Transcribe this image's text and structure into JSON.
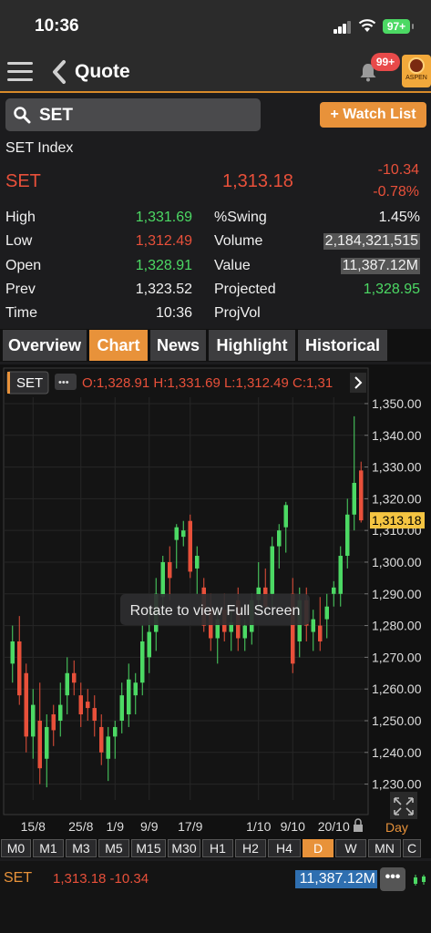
{
  "status_bar": {
    "time": "10:36",
    "battery": "97+"
  },
  "nav": {
    "title": "Quote",
    "notification_badge": "99+",
    "logo_text": "ASPEN"
  },
  "search": {
    "value": "SET",
    "watch_button": "+ Watch List"
  },
  "quote": {
    "index_name": "SET Index",
    "symbol": "SET",
    "last": "1,313.18",
    "change": "-10.34",
    "change_pct": "-0.78%",
    "rows": [
      {
        "l1": "High",
        "v1": "1,331.69",
        "c1": "green",
        "l2": "%Swing",
        "v2": "1.45%",
        "c2": "white",
        "h2": false
      },
      {
        "l1": "Low",
        "v1": "1,312.49",
        "c1": "red",
        "l2": "Volume",
        "v2": "2,184,321,515",
        "c2": "white",
        "h2": true
      },
      {
        "l1": "Open",
        "v1": "1,328.91",
        "c1": "green",
        "l2": "Value",
        "v2": "11,387.12M",
        "c2": "white",
        "h2": true
      },
      {
        "l1": "Prev",
        "v1": "1,323.52",
        "c1": "white",
        "l2": "Projected",
        "v2": "1,328.95",
        "c2": "green",
        "h2": false
      },
      {
        "l1": "Time",
        "v1": "10:36",
        "c1": "white",
        "l2": "ProjVol",
        "v2": "",
        "c2": "white",
        "h2": false
      }
    ]
  },
  "tabs": [
    "Overview",
    "Chart",
    "News",
    "Highlight",
    "Historical"
  ],
  "active_tab": "Chart",
  "chart_header": {
    "symbol": "SET",
    "more": "•••",
    "ohlc": "O:1,328.91  H:1,331.69  L:1,312.49  C:1,31"
  },
  "overlay_text": "Rotate to view Full Screen",
  "timeframe_label": "Day",
  "chart_data": {
    "type": "candlestick",
    "ylim": [
      1225,
      1352
    ],
    "y_ticks": [
      "1,350.00",
      "1,340.00",
      "1,330.00",
      "1,320.00",
      "1,310.00",
      "1,300.00",
      "1,290.00",
      "1,280.00",
      "1,270.00",
      "1,260.00",
      "1,250.00",
      "1,240.00",
      "1,230.00"
    ],
    "y_tick_values": [
      1350,
      1340,
      1330,
      1320,
      1310,
      1300,
      1290,
      1280,
      1270,
      1260,
      1250,
      1240,
      1230
    ],
    "x_ticks": [
      {
        "label": "15/8",
        "index": 3
      },
      {
        "label": "25/8",
        "index": 10
      },
      {
        "label": "1/9",
        "index": 15
      },
      {
        "label": "9/9",
        "index": 20
      },
      {
        "label": "17/9",
        "index": 26
      },
      {
        "label": "1/10",
        "index": 36
      },
      {
        "label": "9/10",
        "index": 41
      },
      {
        "label": "20/10",
        "index": 47
      }
    ],
    "last_price_label": "1,313.18",
    "last_price": 1313.18,
    "up_color": "#4cd964",
    "down_color": "#e8503a",
    "candles": [
      {
        "o": 1268,
        "h": 1280,
        "l": 1262,
        "c": 1275
      },
      {
        "o": 1275,
        "h": 1283,
        "l": 1255,
        "c": 1258
      },
      {
        "o": 1265,
        "h": 1268,
        "l": 1240,
        "c": 1245
      },
      {
        "o": 1245,
        "h": 1260,
        "l": 1238,
        "c": 1255
      },
      {
        "o": 1250,
        "h": 1262,
        "l": 1230,
        "c": 1235
      },
      {
        "o": 1238,
        "h": 1252,
        "l": 1229,
        "c": 1248
      },
      {
        "o": 1252,
        "h": 1255,
        "l": 1242,
        "c": 1247
      },
      {
        "o": 1250,
        "h": 1262,
        "l": 1245,
        "c": 1255
      },
      {
        "o": 1258,
        "h": 1270,
        "l": 1252,
        "c": 1265
      },
      {
        "o": 1265,
        "h": 1269,
        "l": 1258,
        "c": 1262
      },
      {
        "o": 1258,
        "h": 1262,
        "l": 1248,
        "c": 1252
      },
      {
        "o": 1256,
        "h": 1260,
        "l": 1250,
        "c": 1254
      },
      {
        "o": 1254,
        "h": 1258,
        "l": 1245,
        "c": 1250
      },
      {
        "o": 1248,
        "h": 1252,
        "l": 1236,
        "c": 1240
      },
      {
        "o": 1238,
        "h": 1248,
        "l": 1231,
        "c": 1245
      },
      {
        "o": 1245,
        "h": 1250,
        "l": 1238,
        "c": 1248
      },
      {
        "o": 1250,
        "h": 1262,
        "l": 1246,
        "c": 1258
      },
      {
        "o": 1252,
        "h": 1268,
        "l": 1248,
        "c": 1263
      },
      {
        "o": 1258,
        "h": 1265,
        "l": 1252,
        "c": 1262
      },
      {
        "o": 1262,
        "h": 1280,
        "l": 1258,
        "c": 1275
      },
      {
        "o": 1270,
        "h": 1285,
        "l": 1265,
        "c": 1278
      },
      {
        "o": 1278,
        "h": 1295,
        "l": 1272,
        "c": 1290
      },
      {
        "o": 1289,
        "h": 1302,
        "l": 1284,
        "c": 1300
      },
      {
        "o": 1300,
        "h": 1305,
        "l": 1288,
        "c": 1295
      },
      {
        "o": 1307,
        "h": 1312,
        "l": 1298,
        "c": 1311
      },
      {
        "o": 1308,
        "h": 1313,
        "l": 1305,
        "c": 1310
      },
      {
        "o": 1313,
        "h": 1315,
        "l": 1295,
        "c": 1297
      },
      {
        "o": 1298,
        "h": 1305,
        "l": 1290,
        "c": 1302
      },
      {
        "o": 1292,
        "h": 1295,
        "l": 1278,
        "c": 1280
      },
      {
        "o": 1285,
        "h": 1290,
        "l": 1272,
        "c": 1276
      },
      {
        "o": 1276,
        "h": 1285,
        "l": 1268,
        "c": 1282
      },
      {
        "o": 1285,
        "h": 1290,
        "l": 1275,
        "c": 1278
      },
      {
        "o": 1278,
        "h": 1285,
        "l": 1272,
        "c": 1281
      },
      {
        "o": 1288,
        "h": 1292,
        "l": 1272,
        "c": 1276
      },
      {
        "o": 1276,
        "h": 1282,
        "l": 1272,
        "c": 1280
      },
      {
        "o": 1278,
        "h": 1290,
        "l": 1274,
        "c": 1288
      },
      {
        "o": 1288,
        "h": 1300,
        "l": 1284,
        "c": 1292
      },
      {
        "o": 1292,
        "h": 1298,
        "l": 1283,
        "c": 1286
      },
      {
        "o": 1290,
        "h": 1308,
        "l": 1286,
        "c": 1305
      },
      {
        "o": 1305,
        "h": 1312,
        "l": 1298,
        "c": 1310
      },
      {
        "o": 1311,
        "h": 1319,
        "l": 1303,
        "c": 1318
      },
      {
        "o": 1290,
        "h": 1295,
        "l": 1265,
        "c": 1268
      },
      {
        "o": 1275,
        "h": 1292,
        "l": 1270,
        "c": 1288
      },
      {
        "o": 1288,
        "h": 1292,
        "l": 1275,
        "c": 1280
      },
      {
        "o": 1278,
        "h": 1285,
        "l": 1272,
        "c": 1282
      },
      {
        "o": 1280,
        "h": 1289,
        "l": 1272,
        "c": 1275
      },
      {
        "o": 1282,
        "h": 1290,
        "l": 1276,
        "c": 1286
      },
      {
        "o": 1290,
        "h": 1294,
        "l": 1286,
        "c": 1292
      },
      {
        "o": 1290,
        "h": 1305,
        "l": 1286,
        "c": 1302
      },
      {
        "o": 1302,
        "h": 1320,
        "l": 1298,
        "c": 1315
      },
      {
        "o": 1315,
        "h": 1346,
        "l": 1310,
        "c": 1325
      },
      {
        "o": 1328.91,
        "h": 1331.69,
        "l": 1312.49,
        "c": 1313.18
      }
    ]
  },
  "periods": [
    "M0",
    "M1",
    "M3",
    "M5",
    "M15",
    "M30",
    "H1",
    "H2",
    "H4",
    "D",
    "W",
    "MN",
    "C"
  ],
  "active_period": "D",
  "ticker": {
    "symbol": "SET",
    "price": "1,313.18 -10.34",
    "value": "11,387.12M",
    "more": "•••"
  }
}
